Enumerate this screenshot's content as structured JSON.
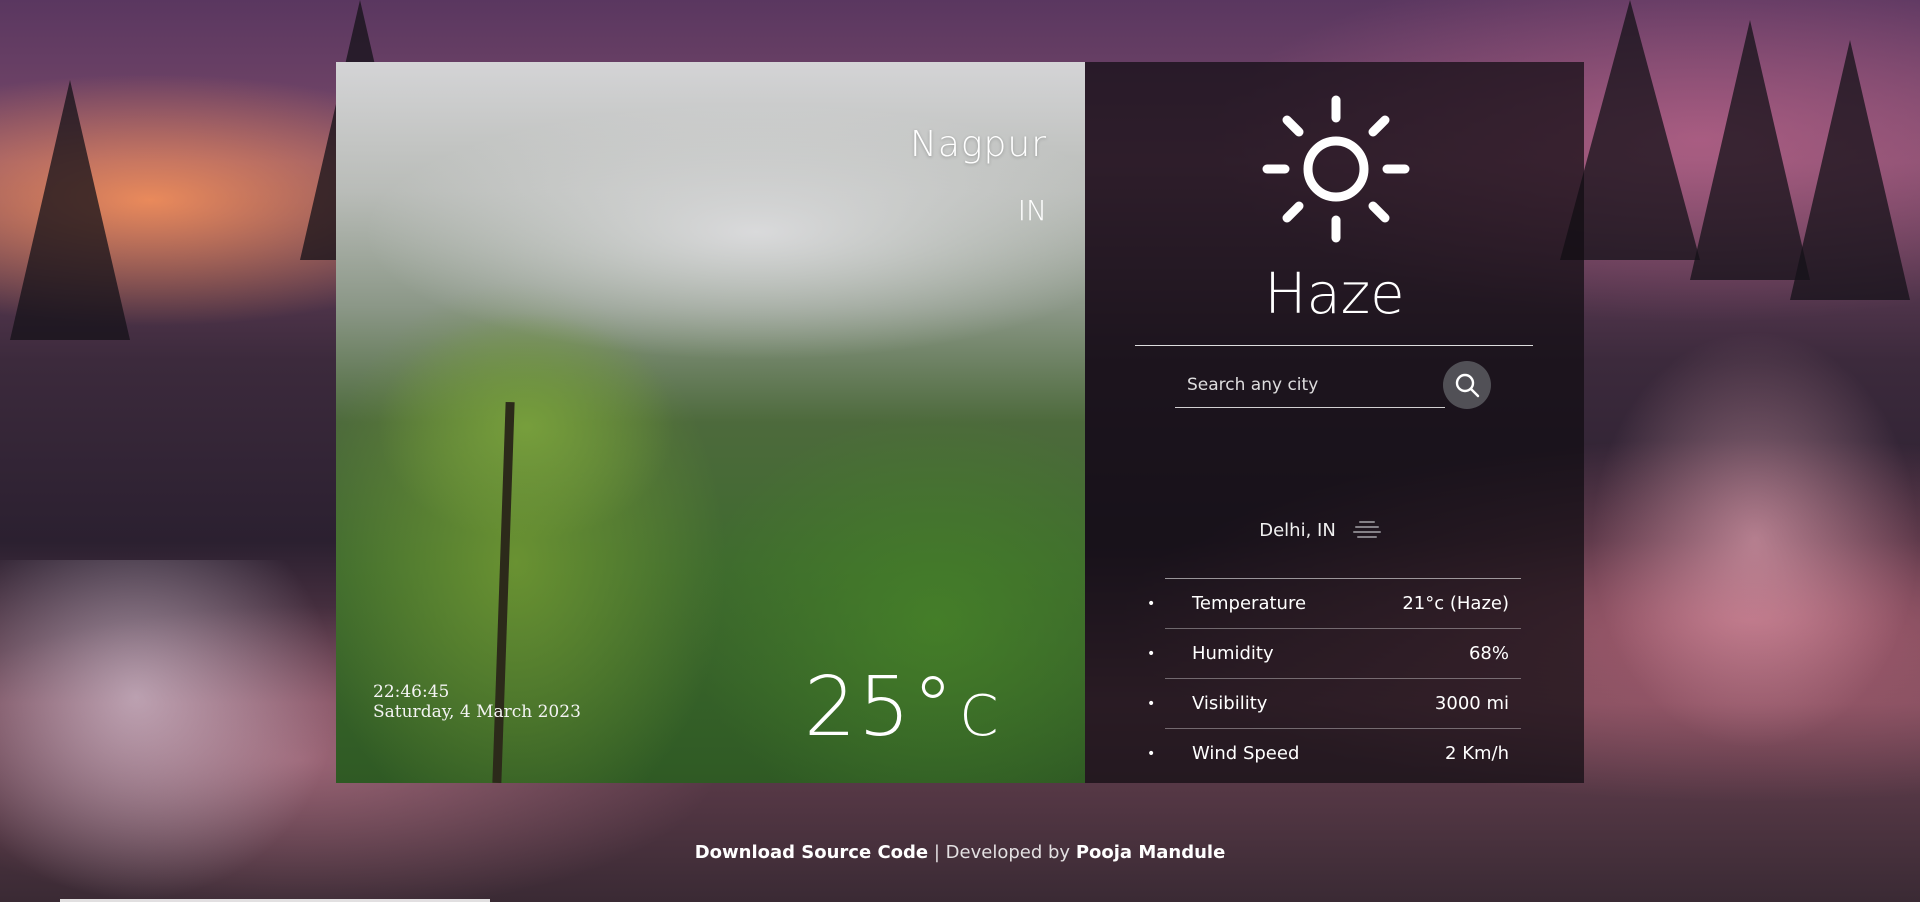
{
  "location_card": {
    "city": "Nagpur",
    "country": "IN",
    "time": "22:46:45",
    "date": "Saturday, 4 March 2023",
    "temperature": "25°",
    "temperature_unit": "C"
  },
  "weather_panel": {
    "condition_icon": "sun-icon",
    "condition": "Haze",
    "search": {
      "placeholder": "Search any city",
      "value": "",
      "button_icon": "search-icon"
    },
    "result": {
      "location": "Delhi, IN",
      "icon": "haze-icon"
    },
    "details": [
      {
        "label": "Temperature",
        "value": "21°c (Haze)"
      },
      {
        "label": "Humidity",
        "value": "68%"
      },
      {
        "label": "Visibility",
        "value": "3000 mi"
      },
      {
        "label": "Wind Speed",
        "value": "2 Km/h"
      }
    ]
  },
  "footer": {
    "source_link": "Download Source Code",
    "separator": "|",
    "developed_by": "Developed by",
    "author": "Pooja Mandule"
  }
}
